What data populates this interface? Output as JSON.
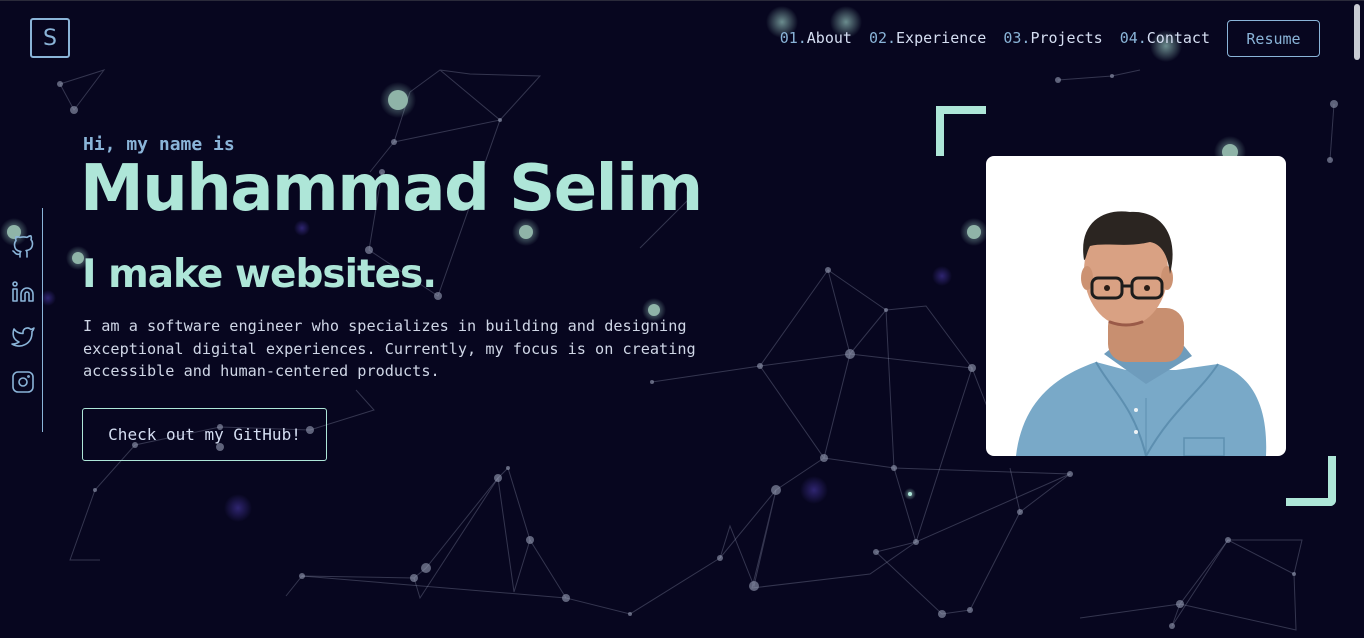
{
  "header": {
    "logo_letter": "S",
    "nav": [
      {
        "num": "01.",
        "label": "About"
      },
      {
        "num": "02.",
        "label": "Experience"
      },
      {
        "num": "03.",
        "label": "Projects"
      },
      {
        "num": "04.",
        "label": "Contact"
      }
    ],
    "resume_label": "Resume"
  },
  "social": {
    "icons": [
      "github-icon",
      "linkedin-icon",
      "twitter-icon",
      "instagram-icon"
    ]
  },
  "hero": {
    "greeting": "Hi, my name is",
    "name": "Muhammad Selim",
    "tagline": "I make websites.",
    "description": "I am a software engineer who specializes in building and designing exceptional digital experiences. Currently, my focus is on creating accessible and human-centered products.",
    "cta_label": "Check out my GitHub!"
  },
  "colors": {
    "background": "#07061f",
    "accent": "#aee6d8",
    "accent_blue": "#8ab4d8",
    "text": "#ccd6f6"
  }
}
